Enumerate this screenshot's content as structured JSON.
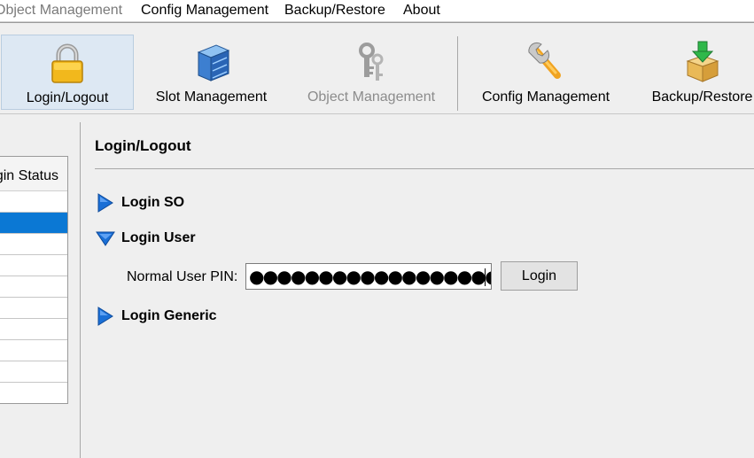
{
  "menubar": {
    "items": [
      {
        "label": "Object Management"
      },
      {
        "label": "Config Management"
      },
      {
        "label": "Backup/Restore"
      },
      {
        "label": "About"
      }
    ]
  },
  "toolbar": {
    "items": [
      {
        "label": "Login/Logout",
        "icon": "lock-icon",
        "active": true,
        "disabled": false
      },
      {
        "label": "Slot Management",
        "icon": "cabinet-icon",
        "active": false,
        "disabled": false
      },
      {
        "label": "Object Management",
        "icon": "keys-icon",
        "active": false,
        "disabled": true
      },
      {
        "label": "Config Management",
        "icon": "wrench-icon",
        "active": false,
        "disabled": false
      },
      {
        "label": "Backup/Restore",
        "icon": "box-download-icon",
        "active": false,
        "disabled": false
      }
    ]
  },
  "left_panel": {
    "header": "Login Status",
    "selected_row": 1
  },
  "content": {
    "title": "Login/Logout",
    "sections": [
      {
        "label": "Login SO",
        "expanded": false
      },
      {
        "label": "Login User",
        "expanded": true
      },
      {
        "label": "Login Generic",
        "expanded": false
      }
    ],
    "pin_label": "Normal User PIN:",
    "pin_value": "●●●●●●●●●●●●●●●●●●●",
    "login_button": "Login"
  },
  "colors": {
    "selection": "#0b78d4",
    "active_tool_bg": "#dde8f3",
    "triangle": "#1a6fd6"
  }
}
